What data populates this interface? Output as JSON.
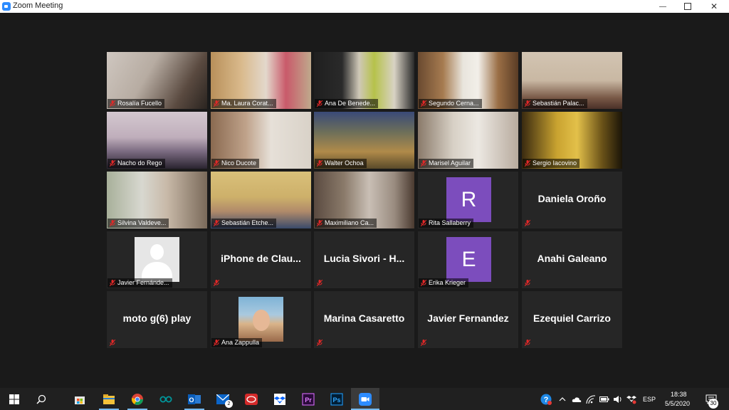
{
  "window": {
    "title": "Zoom Meeting",
    "minimize": "—",
    "close": "✕"
  },
  "tiles": [
    {
      "label": "Rosalía Fucello",
      "type": "video",
      "bg": "linear-gradient(120deg,#cfc7c0 0%,#b7aca2 40%,#5a4a40 75%,#2a2420 100%)"
    },
    {
      "label": "Ma. Laura Corat...",
      "type": "video",
      "bg": "linear-gradient(90deg,#b8905a 0%,#d9b98b 30%,#e3d8cc 55%,#c95a6a 75%,#bfa98c 100%)"
    },
    {
      "label": "Ana De Benede...",
      "type": "video",
      "bg": "linear-gradient(90deg,#1f1f1f 0%,#2a2a2a 28%,#cfc8b8 45%,#b6c24a 60%,#d8d2c4 80%,#2a2a2a 100%)"
    },
    {
      "label": "Segundo Cerna...",
      "type": "video",
      "bg": "linear-gradient(90deg,#6a4a30 0%,#a67b50 25%,#e9e5dd 45%,#f2efe9 60%,#9a6e45 80%,#5a3c25 100%)"
    },
    {
      "label": "Sebastián Palac...",
      "type": "video",
      "bg": "linear-gradient(180deg,#d2c4b2 0%,#c9b8a3 50%,#7a5a48 80%,#4a3028 100%)"
    },
    {
      "label": "Nacho do Rego",
      "type": "video",
      "bg": "linear-gradient(180deg,#d4c8d0 0%,#bfaebb 45%,#7a6a80 70%,#2a2430 100%)"
    },
    {
      "label": "Nico Ducote",
      "type": "video",
      "bg": "linear-gradient(90deg,#8a6a50 0%,#bfa28a 35%,#e6e0d8 60%,#d9d2c8 100%)"
    },
    {
      "label": "Walter Ochoa",
      "type": "video",
      "bg": "linear-gradient(180deg,#3a4a78 0%,#6c6e5a 35%,#b08a4a 70%,#5a4a2a 100%)"
    },
    {
      "label": "Marisel Aguilar",
      "type": "video",
      "bg": "linear-gradient(90deg,#8a7a6a 0%,#d7d0c5 35%,#ece8e2 60%,#b8ab9e 100%)"
    },
    {
      "label": "Sergio Iacovino",
      "type": "video",
      "bg": "linear-gradient(90deg,#3a2a10 0%,#c9a330 35%,#e3c04a 55%,#6a5218 80%,#1a1408 100%)"
    },
    {
      "label": "Silvina Valdeve...",
      "type": "video",
      "bg": "linear-gradient(90deg,#a8b09a 0%,#d8d8d0 35%,#c8b9a8 60%,#7a6a5a 100%)"
    },
    {
      "label": "Sebastián Etche...",
      "type": "video",
      "bg": "linear-gradient(180deg,#d9c07a 0%,#cdb06a 45%,#b08a6a 70%,#3a4a6a 100%)"
    },
    {
      "label": "Maximiliano Ca...",
      "type": "video",
      "bg": "linear-gradient(90deg,#5a4a40 0%,#8a7a6a 30%,#c9bfb5 55%,#9a8c80 80%,#4a3a30 100%)"
    },
    {
      "label": "Rita Sallaberry",
      "type": "letter",
      "letter": "R"
    },
    {
      "label": "",
      "type": "name",
      "name": "Daniela Oroño"
    },
    {
      "label": "Javier Fernánde...",
      "type": "default"
    },
    {
      "label": "",
      "type": "name",
      "name": "iPhone de Clau..."
    },
    {
      "label": "",
      "type": "name",
      "name": "Lucia Sivori - H..."
    },
    {
      "label": "Erika Krieger",
      "type": "letter",
      "letter": "E"
    },
    {
      "label": "",
      "type": "name",
      "name": "Anahi Galeano"
    },
    {
      "label": "",
      "type": "name",
      "name": "moto g(6) play"
    },
    {
      "label": "Ana Zappulla",
      "type": "photo"
    },
    {
      "label": "",
      "type": "name",
      "name": "Marina Casaretto"
    },
    {
      "label": "",
      "type": "name",
      "name": "Javier Fernandez"
    },
    {
      "label": "",
      "type": "name",
      "name": "Ezequiel Carrizo"
    }
  ],
  "taskbar": {
    "apps": [
      "windows-start-icon",
      "search-icon",
      "store-icon",
      "file-explorer-icon",
      "chrome-icon",
      "arduino-icon",
      "outlook-icon",
      "mail-icon",
      "red-app-icon",
      "dropbox-icon",
      "premiere-icon",
      "photoshop-icon",
      "zoom-icon"
    ],
    "mail_badge": "2",
    "language": "ESP",
    "time": "18:38",
    "date": "5/5/2020",
    "notification_count": "30"
  },
  "colors": {
    "tile_bg": "#262626",
    "avatar_purple": "#7c4dbd",
    "mute_red": "#e02828",
    "zoom_blue": "#2d8cff"
  }
}
